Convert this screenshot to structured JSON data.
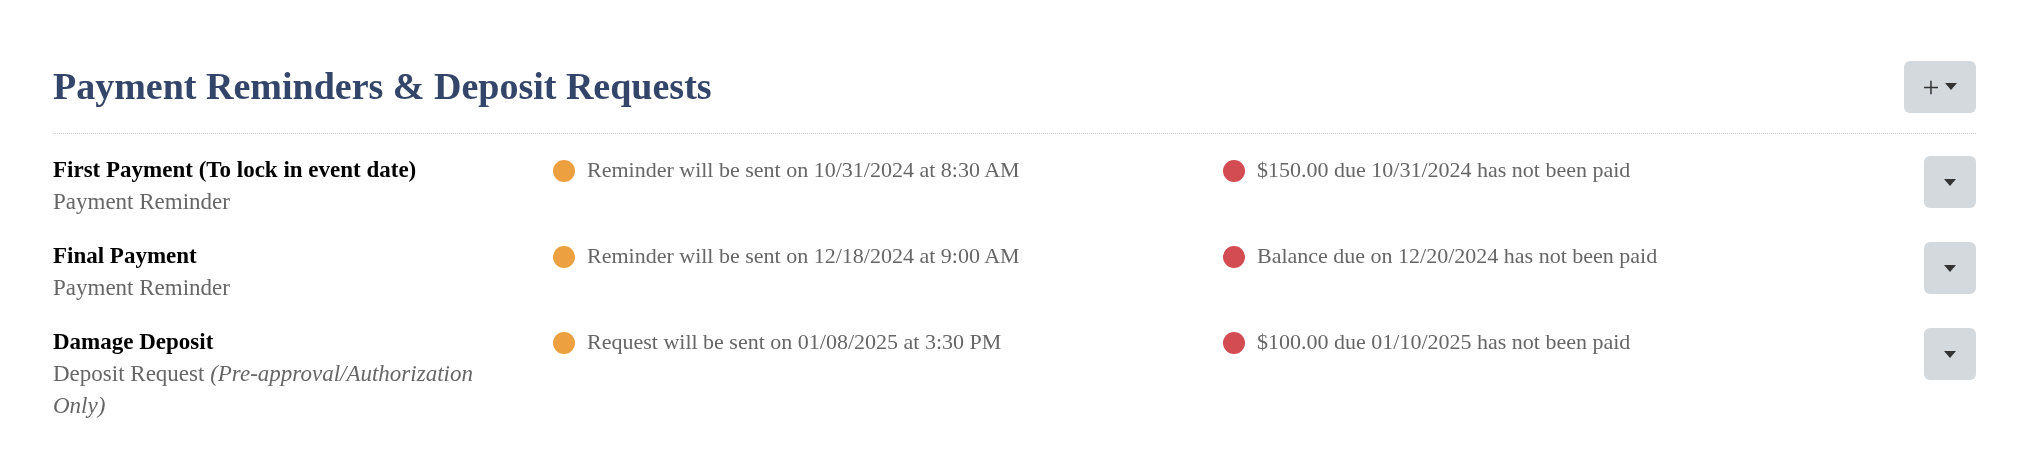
{
  "section": {
    "title": "Payment Reminders & Deposit Requests",
    "add_button": {
      "label": "+"
    }
  },
  "items": [
    {
      "name": "First Payment (To lock in event date)",
      "type": "Payment Reminder",
      "schedule": {
        "text": "Reminder will be sent on 10/31/2024 at 8:30 AM",
        "color": "#eda040"
      },
      "status": {
        "text": "$150.00 due 10/31/2024 has not been paid",
        "color": "#d24c52"
      }
    },
    {
      "name": "Final Payment",
      "type": "Payment Reminder",
      "schedule": {
        "text": "Reminder will be sent on 12/18/2024 at 9:00 AM",
        "color": "#eda040"
      },
      "status": {
        "text": "Balance due on 12/20/2024 has not been paid",
        "color": "#d24c52"
      }
    },
    {
      "name": "Damage Deposit",
      "type": "Deposit Request *(Pre-approval/Authorization Only)*",
      "schedule": {
        "text": "Request will be sent on 01/08/2025 at 3:30 PM",
        "color": "#eda040"
      },
      "status": {
        "text": "$100.00 due 01/10/2025 has not been paid",
        "color": "#d24c52"
      }
    }
  ]
}
